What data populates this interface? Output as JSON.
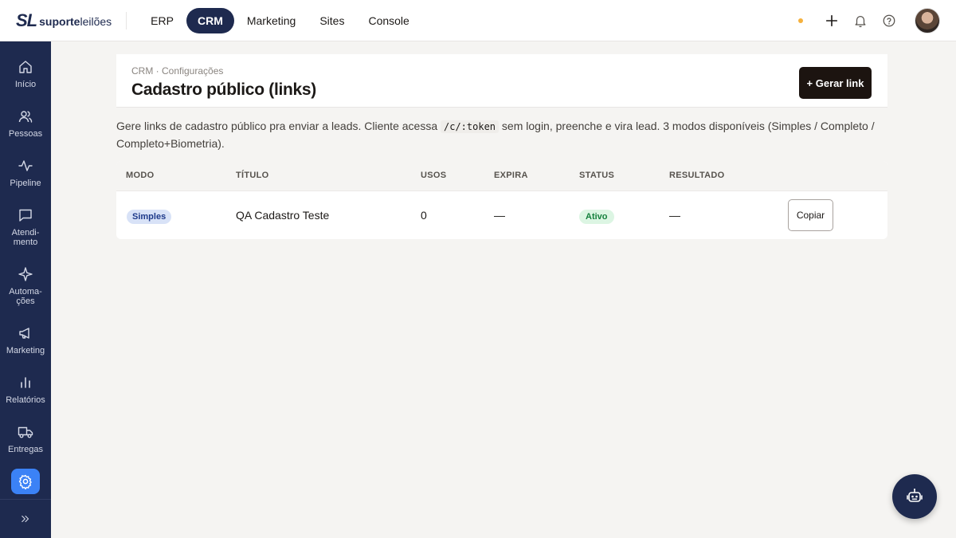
{
  "brand": {
    "mark": "SL",
    "name_bold": "suporte",
    "name_rest": "leilões"
  },
  "topnav": {
    "items": [
      "ERP",
      "CRM",
      "Marketing",
      "Sites",
      "Console"
    ],
    "active": "CRM"
  },
  "sidebar": {
    "items": [
      {
        "label": "Início",
        "icon": "home-icon"
      },
      {
        "label": "Pessoas",
        "icon": "users-icon"
      },
      {
        "label": "Pipeline",
        "icon": "activity-icon"
      },
      {
        "label": "Atendi-\nmento",
        "icon": "chat-icon"
      },
      {
        "label": "Automa-\nções",
        "icon": "sparkle-icon"
      },
      {
        "label": "Marketing",
        "icon": "megaphone-icon"
      },
      {
        "label": "Relatórios",
        "icon": "bar-chart-icon"
      },
      {
        "label": "Entregas",
        "icon": "truck-icon"
      }
    ],
    "active_icon": "gear-icon",
    "collapse_icon": "chevrons-right-icon"
  },
  "page": {
    "breadcrumb": "CRM · Configurações",
    "title": "Cadastro público (links)",
    "generate_label": "+ Gerar link",
    "desc_before": "Gere links de cadastro público pra enviar a leads. Cliente acessa ",
    "desc_code": "/c/:token",
    "desc_after": " sem login, preenche e vira lead. 3 modos disponíveis (Simples / Completo / Completo+Biometria)."
  },
  "table": {
    "headers": [
      "MODO",
      "TÍTULO",
      "USOS",
      "EXPIRA",
      "STATUS",
      "RESULTADO"
    ],
    "rows": [
      {
        "modo": "Simples",
        "titulo": "QA Cadastro Teste",
        "usos": "0",
        "expira": "—",
        "status": "Ativo",
        "resultado": "—",
        "action": "Copiar"
      }
    ]
  },
  "colors": {
    "navy": "#1e2a4f",
    "accent_blue": "#3b82f6",
    "status_dot": "#f5b13d"
  }
}
